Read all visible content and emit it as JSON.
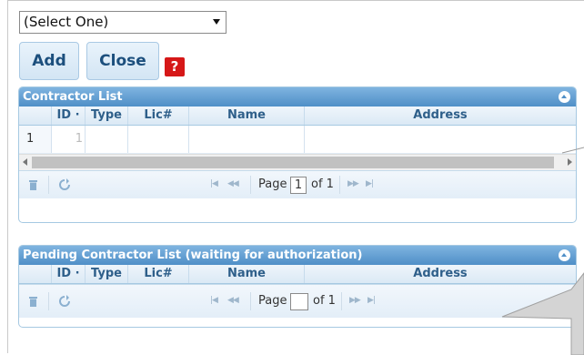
{
  "select": {
    "value": "(Select One)"
  },
  "buttons": {
    "add": "Add",
    "close": "Close",
    "help": "?"
  },
  "contractor_list": {
    "title": "Contractor List",
    "columns": [
      "ID",
      "Type",
      "Lic#",
      "Name",
      "Address"
    ],
    "rows": [
      {
        "num": "1",
        "id_fragment": "1"
      }
    ],
    "pager": {
      "page_label": "Page",
      "page_value": "1",
      "of_label": "of 1"
    }
  },
  "pending_list": {
    "title": "Pending Contractor List (waiting for authorization)",
    "columns": [
      "ID",
      "Type",
      "Lic#",
      "Name",
      "Address"
    ],
    "pager": {
      "page_label": "Page",
      "page_value": "",
      "of_label": "of 1"
    }
  }
}
